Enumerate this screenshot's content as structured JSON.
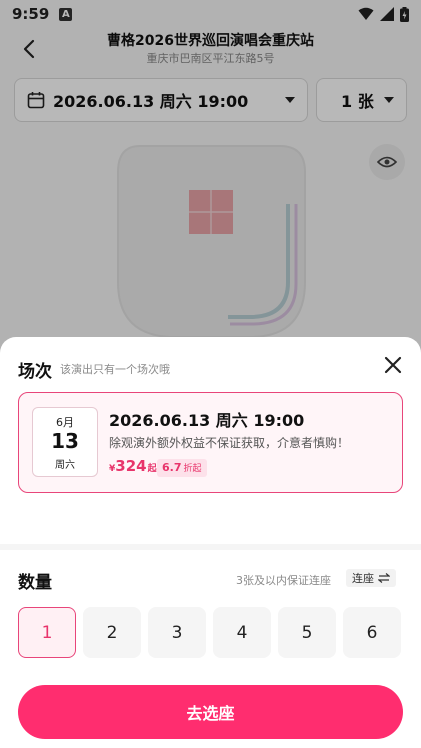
{
  "status_bar": {
    "time": "9:59",
    "notification_icon": "A"
  },
  "header": {
    "title": "曹格2026世界巡回演唱会重庆站",
    "venue": "重庆市巴南区平江东路5号"
  },
  "filters": {
    "date_label": "2026.06.13 周六 19:00",
    "quantity_label": "1 张"
  },
  "sheet": {
    "title": "场次",
    "hint": "该演出只有一个场次哦",
    "session": {
      "month": "6月",
      "day": "13",
      "weekday": "周六",
      "datetime": "2026.06.13 周六 19:00",
      "note": "除观演外额外权益不保证获取，介意者慎购！",
      "price_currency": "¥",
      "price_value": "324",
      "price_suffix": "起",
      "discount_value": "6.7",
      "discount_label": "折起"
    },
    "quantity": {
      "title": "数量",
      "note": "3张及以内保证连座",
      "lianzuo_label": "连座",
      "options": [
        "1",
        "2",
        "3",
        "4",
        "5",
        "6"
      ],
      "selected": "1"
    },
    "cta_label": "去选座"
  },
  "colors": {
    "accent": "#e8457a",
    "primary_button": "#ff2d6f",
    "price": "#e8346b"
  }
}
